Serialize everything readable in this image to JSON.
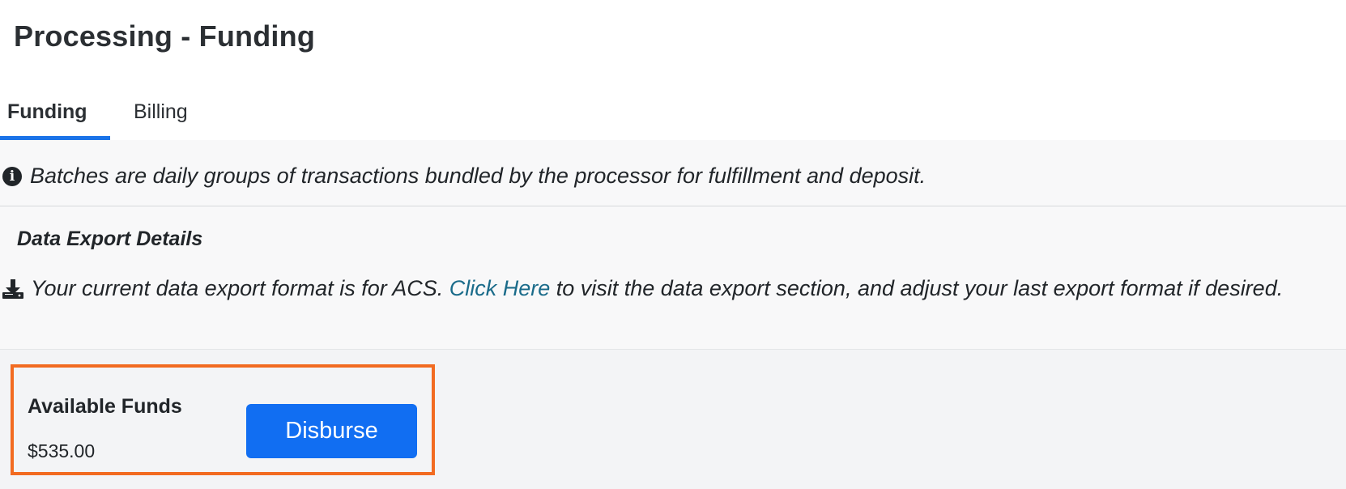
{
  "page": {
    "title": "Processing - Funding"
  },
  "tabs": [
    {
      "label": "Funding",
      "active": true
    },
    {
      "label": "Billing",
      "active": false
    }
  ],
  "info": {
    "icon": "info-circle-icon",
    "text": "Batches are daily groups of transactions bundled by the processor for fulfillment and deposit."
  },
  "export": {
    "heading": "Data Export Details",
    "icon": "download-icon",
    "text_before": "Your current data export format is for ACS. ",
    "link_label": "Click Here",
    "text_after": " to visit the data export section, and adjust your last export format if desired."
  },
  "funds": {
    "label": "Available Funds",
    "amount": "$535.00",
    "button_label": "Disburse"
  },
  "colors": {
    "accent": "#116ef2",
    "tab_underline": "#1a73e8",
    "highlight_border": "#f26b21",
    "link": "#1a6b8a"
  }
}
